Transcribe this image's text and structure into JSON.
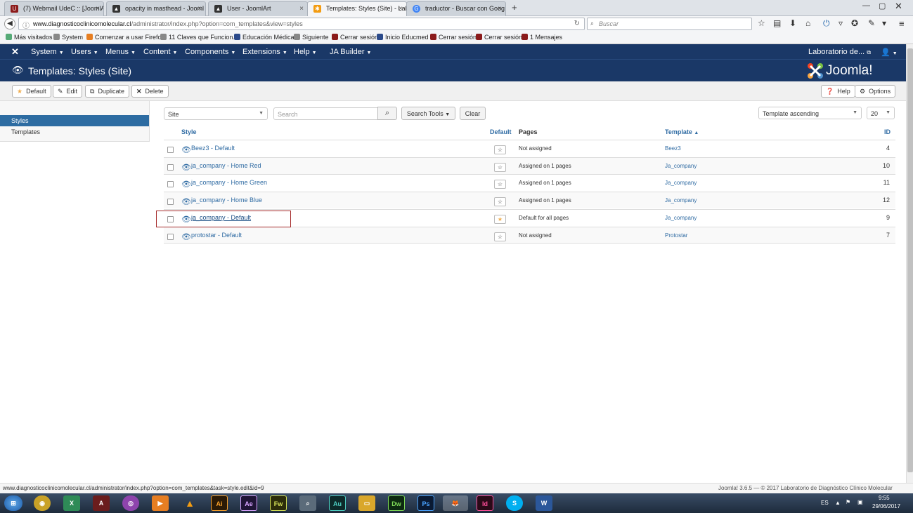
{
  "browser": {
    "tabs": [
      {
        "label": "(7) Webmail UdeC :: [JoomlA",
        "active": false
      },
      {
        "label": "opacity in masthead - Jooml",
        "active": false
      },
      {
        "label": "User - JoomlArt",
        "active": false
      },
      {
        "label": "Templates: Styles (Site) - Lab",
        "active": true
      },
      {
        "label": "traductor - Buscar con Goog",
        "active": false
      }
    ],
    "new_tab": "+",
    "url_domain": "www.diagnosticoclinicomolecular.cl",
    "url_path": "/administrator/index.php?option=com_templates&view=styles",
    "search_placeholder": "Buscar",
    "bookmarks": [
      "Más visitados",
      "System",
      "Comenzar a usar Firefox",
      "11 Claves que Funcion...",
      "Educación Médica",
      "Siguiente",
      "Cerrar sesión",
      "Inicio Educmed",
      "Cerrar sesión",
      "Cerrar sesión",
      "1 Mensajes"
    ]
  },
  "joomla": {
    "menu": [
      "System",
      "Users",
      "Menus",
      "Content",
      "Components",
      "Extensions",
      "Help",
      "JA Builder"
    ],
    "site_name": "Laboratorio de...",
    "page_title": "Templates: Styles (Site)",
    "logo_text": "Joomla!",
    "toolbar": {
      "default": "Default",
      "edit": "Edit",
      "duplicate": "Duplicate",
      "delete": "Delete",
      "help": "Help",
      "options": "Options"
    },
    "sidebar": [
      {
        "label": "Styles",
        "active": true
      },
      {
        "label": "Templates",
        "active": false
      }
    ],
    "filter": {
      "client": "Site",
      "search_placeholder": "Search",
      "search_tools": "Search Tools",
      "clear": "Clear",
      "ordering": "Template ascending",
      "limit": "20"
    },
    "columns": {
      "style": "Style",
      "default": "Default",
      "pages": "Pages",
      "template": "Template",
      "id": "ID"
    },
    "rows": [
      {
        "style": "Beez3 - Default",
        "is_default": false,
        "pages": "Not assigned",
        "template": "Beez3",
        "id": "4"
      },
      {
        "style": "ja_company - Home Red",
        "is_default": false,
        "pages": "Assigned on 1 pages",
        "template": "Ja_company",
        "id": "10"
      },
      {
        "style": "ja_company - Home Green",
        "is_default": false,
        "pages": "Assigned on 1 pages",
        "template": "Ja_company",
        "id": "11"
      },
      {
        "style": "ja_company - Home Blue",
        "is_default": false,
        "pages": "Assigned on 1 pages",
        "template": "Ja_company",
        "id": "12"
      },
      {
        "style": "ja_company - Default",
        "is_default": true,
        "pages": "Default for all pages",
        "template": "Ja_company",
        "id": "9"
      },
      {
        "style": "protostar - Default",
        "is_default": false,
        "pages": "Not assigned",
        "template": "Protostar",
        "id": "7"
      }
    ],
    "footer": "Joomla! 3.6.5  —  © 2017 Laboratorio de Diagnóstico Clínico Molecular"
  },
  "status_url": "www.diagnosticoclinicomolecular.cl/administrator/index.php?option=com_templates&task=style.edit&id=9",
  "taskbar": {
    "lang": "ES",
    "time": "9:55",
    "date": "29/06/2017",
    "apps": [
      "Ai",
      "Ae",
      "Fw",
      "Au",
      "Dw",
      "Ps",
      "Id"
    ]
  },
  "colors": {
    "joomla_nav": "#1a3867",
    "link": "#2f6ba3",
    "active_sidebar": "#2d6ca2",
    "highlight_box": "#a52a2a",
    "star_default": "#f0ad4e"
  }
}
